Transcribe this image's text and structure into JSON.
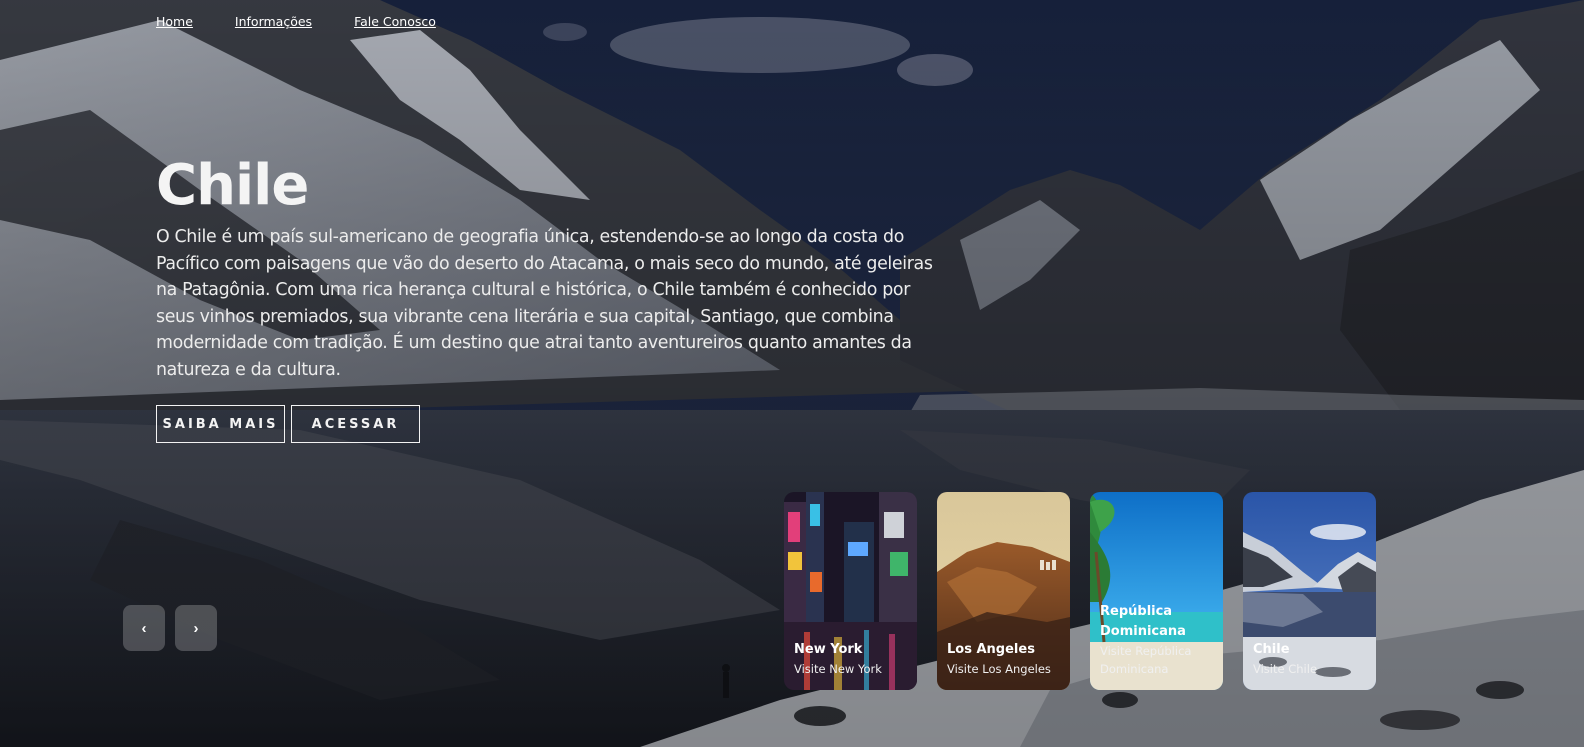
{
  "nav": {
    "items": [
      "Home",
      "Informações",
      "Fale Conosco"
    ]
  },
  "hero": {
    "title": "Chile",
    "description": "O Chile é um país sul-americano de geografia única, estendendo-se ao longo da costa do Pacífico com paisagens que vão do deserto do Atacama, o mais seco do mundo, até geleiras na Patagônia. Com uma rica herança cultural e histórica, o Chile também é conhecido por seus vinhos premiados, sua vibrante cena literária e sua capital, Santiago, que combina modernidade com tradição. É um destino que atrai tanto aventureiros quanto amantes da natureza e da cultura.",
    "buttons": {
      "learn_more": "SAIBA MAIS",
      "access": "ACESSAR"
    }
  },
  "controls": {
    "prev": "‹",
    "next": "›"
  },
  "cards": [
    {
      "title": "New York",
      "subtitle": "Visite New York",
      "image": "city-night-icon"
    },
    {
      "title": "Los Angeles",
      "subtitle": "Visite Los Angeles",
      "image": "desert-hills-icon"
    },
    {
      "title": "República Dominicana",
      "subtitle": "Visite República Dominicana",
      "image": "beach-palm-icon"
    },
    {
      "title": "Chile",
      "subtitle": "Visite Chile",
      "image": "mountain-lake-icon"
    }
  ],
  "colors": {
    "sky": "#1e2a4a",
    "snow": "#d9dde3",
    "button_border": "#f3f3f3"
  }
}
